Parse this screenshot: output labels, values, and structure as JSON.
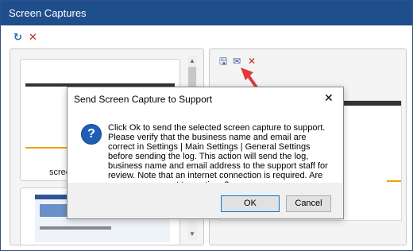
{
  "window": {
    "title": "Screen Captures"
  },
  "toolbar": {
    "refresh_icon": "refresh-icon",
    "delete_icon": "close-icon"
  },
  "left_panel": {
    "thumbnail_label": "scree"
  },
  "right_panel": {
    "icons": [
      "save-icon",
      "email-icon",
      "delete-icon"
    ]
  },
  "dialog": {
    "title": "Send Screen Capture to Support",
    "message": "Click Ok to send the selected screen capture to support. Please verify that the business name and email are correct in Settings | Main Settings | General Settings before sending the log. This action will send the log, business name and email address to the support staff for review. Note that an internet connection is required. Are you sure you want to continue?",
    "ok_label": "OK",
    "cancel_label": "Cancel",
    "close_symbol": "✕",
    "icon_glyph": "?"
  },
  "colors": {
    "titlebar": "#1f4e8c",
    "accent_arrow": "#e03a3a",
    "delete": "#c0282d"
  }
}
